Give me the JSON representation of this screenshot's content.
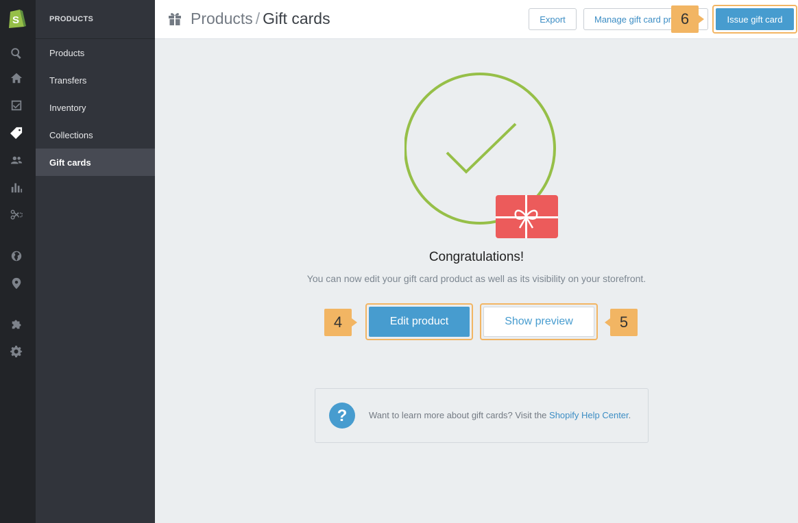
{
  "sidebar": {
    "section_title": "PRODUCTS",
    "items": [
      {
        "label": "Products"
      },
      {
        "label": "Transfers"
      },
      {
        "label": "Inventory"
      },
      {
        "label": "Collections"
      },
      {
        "label": "Gift cards"
      }
    ],
    "active_index": 4
  },
  "rail_icons": [
    "search-icon",
    "home-icon",
    "orders-icon",
    "tag-icon",
    "customers-icon",
    "reports-icon",
    "discounts-icon",
    "globe-icon",
    "location-icon",
    "apps-icon",
    "settings-icon"
  ],
  "header": {
    "breadcrumb_parent": "Products",
    "breadcrumb_separator": "/",
    "breadcrumb_current": "Gift cards",
    "export_label": "Export",
    "manage_label": "Manage gift card pr",
    "issue_label": "Issue gift card"
  },
  "callouts": {
    "edit": "4",
    "preview": "5",
    "issue": "6"
  },
  "main": {
    "title": "Congratulations!",
    "subtitle": "You can now edit your gift card product as well as its visibility on your storefront.",
    "edit_label": "Edit product",
    "preview_label": "Show preview"
  },
  "help": {
    "text": "Want to learn more about gift cards? Visit the ",
    "link": "Shopify Help Center",
    "suffix": "."
  },
  "colors": {
    "accent": "#479ccf",
    "success": "#96bf48",
    "gift_card": "#ec5b5b",
    "callout": "#f2b563",
    "rail": "#222428",
    "sidebar": "#31343b"
  }
}
